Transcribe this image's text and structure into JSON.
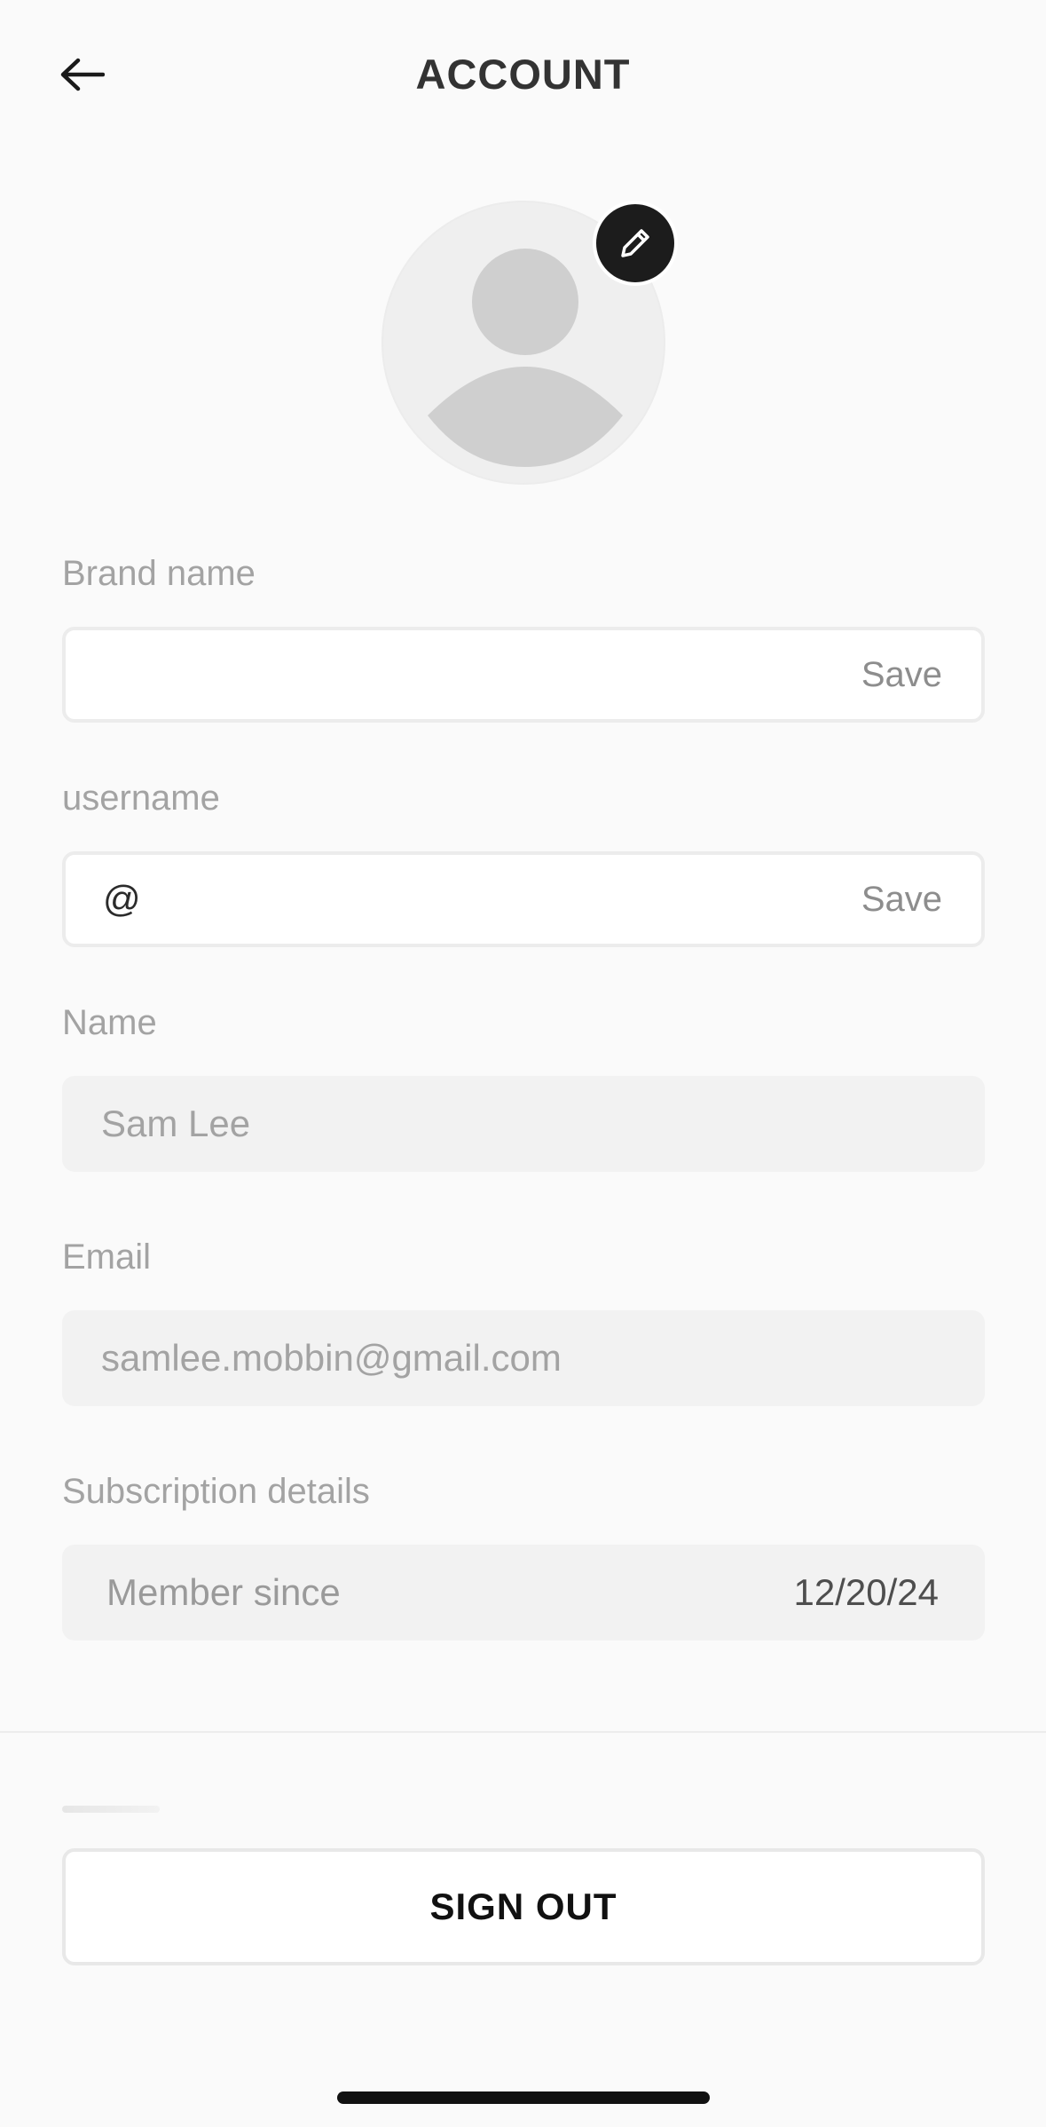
{
  "header": {
    "title": "ACCOUNT",
    "back_icon": "arrow-left-icon"
  },
  "avatar": {
    "placeholder_icon": "person-silhouette-icon",
    "edit_icon": "pencil-icon"
  },
  "fields": {
    "brand_name": {
      "label": "Brand name",
      "value": "",
      "action": "Save"
    },
    "username": {
      "label": "username",
      "prefix": "@",
      "value": "",
      "action": "Save"
    },
    "name": {
      "label": "Name",
      "value": "Sam Lee"
    },
    "email": {
      "label": "Email",
      "value": "samlee.mobbin@gmail.com"
    },
    "subscription": {
      "label": "Subscription details",
      "key": "Member since",
      "value": "12/20/24"
    }
  },
  "footer": {
    "sign_out_label": "SIGN OUT"
  },
  "colors": {
    "background": "#fafafa",
    "edit_badge": "#1c1c1c",
    "label_text": "#a3a3a3"
  }
}
